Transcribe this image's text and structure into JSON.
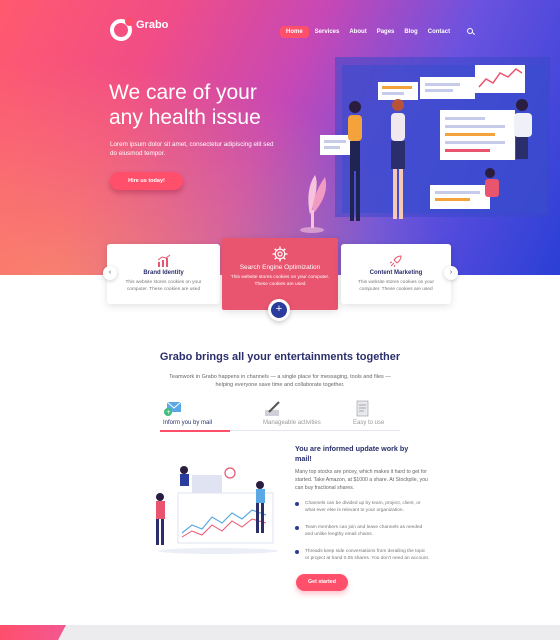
{
  "brand": {
    "name": "Grabo"
  },
  "nav": {
    "items": [
      "Home",
      "Services",
      "About",
      "Pages",
      "Blog",
      "Contact"
    ],
    "active_index": 0
  },
  "hero": {
    "title_line1": "We care of your",
    "title_line2": "any health issue",
    "subtitle": "Lorem ipsum dolor sit amet, consectetur adipiscing elit sed do eiusmod tempor.",
    "cta": "Hire us today!"
  },
  "cards": [
    {
      "title": "Brand Identity",
      "text": "This website stores cookies on your computer. These cookies are used",
      "icon": "chart-icon"
    },
    {
      "title": "Search Engine Optimization",
      "text": "This website stores cookies on your computer. These cookies are used",
      "icon": "gear-icon"
    },
    {
      "title": "Content Marketing",
      "text": "This website stores cookies on your computer. These cookies are used",
      "icon": "rocket-icon"
    }
  ],
  "section": {
    "title": "Grabo brings all your entertainments together",
    "subtitle": "Teamwork in Grabo happens in channels — a single place for messaging, tools and files — helping everyone save time and collaborate together."
  },
  "tabs": [
    {
      "label": "Inform you by mail",
      "icon": "mail-icon"
    },
    {
      "label": "Manageable activities",
      "icon": "pen-icon"
    },
    {
      "label": "Easy to use",
      "icon": "document-icon"
    }
  ],
  "info": {
    "title": "You are informed update work by mail!",
    "text": "Many top stocks are pricey, which makes it hard to get for started. Take Amazon, at $1000 a share. At Stockpile, you can buy fractional shares.",
    "bullets": [
      "Channels can be divided up by team, project, client, or what ever else is relevant to your organization.",
      "Team members can join and leave channels as needed and unlike lengthy email chains.",
      "Threads keep side conversations from derailing the topic or project at hand 0.05 shares. You don't need an account."
    ],
    "cta": "Get started"
  },
  "colors": {
    "accent": "#ff4f6b",
    "navy": "#2a2f6c",
    "hero_start": "#ff5a6e",
    "hero_end": "#2a3fd6"
  }
}
